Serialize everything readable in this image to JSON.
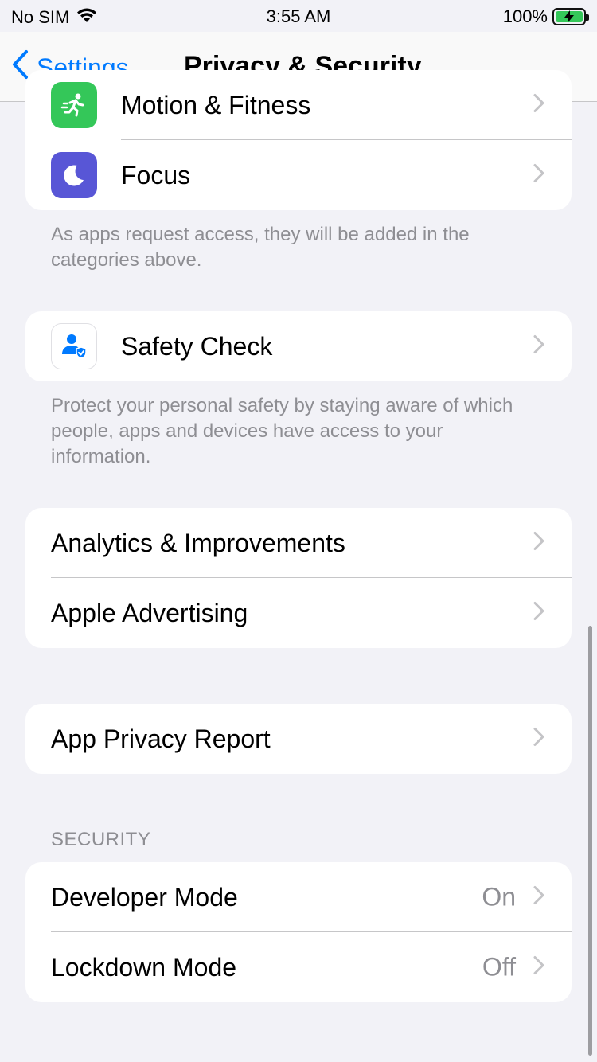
{
  "status_bar": {
    "carrier": "No SIM",
    "time": "3:55 AM",
    "battery": "100%"
  },
  "nav": {
    "back_label": "Settings",
    "title": "Privacy & Security"
  },
  "group1": {
    "rows": [
      {
        "label": "Motion & Fitness",
        "icon": "running-figure-icon",
        "color": "#34c759"
      },
      {
        "label": "Focus",
        "icon": "moon-icon",
        "color": "#5856d6"
      }
    ],
    "footer": "As apps request access, they will be added in the categories above."
  },
  "safety_check": {
    "label": "Safety Check",
    "icon": "person-shield-icon",
    "footer": "Protect your personal safety by staying aware of which people, apps and devices have access to your information."
  },
  "group3": {
    "rows": [
      {
        "label": "Analytics & Improvements"
      },
      {
        "label": "Apple Advertising"
      }
    ]
  },
  "group4": {
    "rows": [
      {
        "label": "App Privacy Report"
      }
    ]
  },
  "security": {
    "header": "SECURITY",
    "rows": [
      {
        "label": "Developer Mode",
        "value": "On"
      },
      {
        "label": "Lockdown Mode",
        "value": "Off"
      }
    ]
  },
  "colors": {
    "accent": "#007aff",
    "background": "#f2f2f7",
    "secondary_text": "#8e8e93",
    "separator": "#c6c6c8"
  }
}
